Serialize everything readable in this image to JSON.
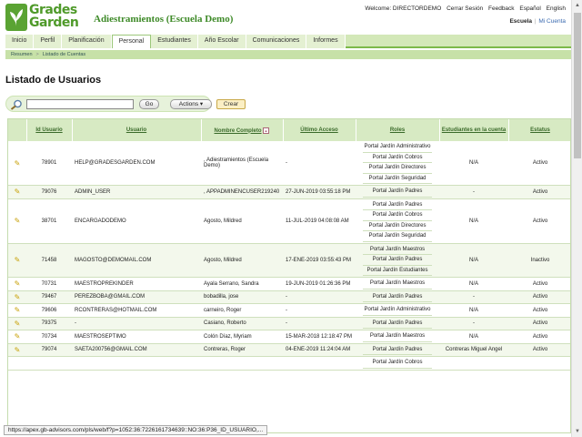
{
  "brand": {
    "logo_line1": "Grades",
    "logo_line2": "Garden",
    "app_title": "Adiestramientos (Escuela Demo)"
  },
  "top_links": {
    "welcome": "Welcome: DIRECTORDEMO",
    "logout": "Cerrar Sesión",
    "feedback": "Feedback",
    "lang_es": "Español",
    "lang_en": "English"
  },
  "account": {
    "school": "Escuela",
    "sep": "|",
    "my_account": "Mi Cuenta"
  },
  "nav": {
    "tabs": [
      "Inicio",
      "Perfil",
      "Planificación",
      "Personal",
      "Estudiantes",
      "Año Escolar",
      "Comunicaciones",
      "Informes"
    ],
    "active": "Personal"
  },
  "breadcrumb": {
    "items": [
      "Resumen",
      "Listado de Cuentas"
    ],
    "sep": ">"
  },
  "page": {
    "title": "Listado de Usuarios"
  },
  "toolbar": {
    "search_value": "",
    "go_label": "Go",
    "actions_label": "Actions ▾",
    "create_label": "Crear"
  },
  "table": {
    "headers": [
      "Id Usuario",
      "Usuario",
      "Nombre Completo",
      "Último Acceso",
      "Roles",
      "Estudiantes en la cuenta",
      "Estatus"
    ],
    "sort_arrow": "▲",
    "edit_icon": "✎",
    "rows": [
      {
        "id": "78901",
        "user": "HELP@GRADESGARDEN.COM",
        "name": ", Adiestramientos (Escuela Demo)",
        "last": "-",
        "roles": [
          "Portal Jardín Administrativo",
          "Portal Jardín Cobros",
          "Portal Jardín Directores",
          "Portal Jardín Seguridad"
        ],
        "students": "N/A",
        "status": "Activo"
      },
      {
        "id": "79076",
        "user": "ADMIN_USER",
        "name": ", APPADMINENCUSER219240",
        "last": "27-JUN-2019 03:55:18 PM",
        "roles": [
          "Portal Jardín Padres"
        ],
        "students": "-",
        "status": "Activo"
      },
      {
        "id": "38701",
        "user": "ENCARGADODEMO",
        "name": "Agosto, Mildred",
        "last": "11-JUL-2019 04:08:08 AM",
        "roles": [
          "Portal Jardín Padres",
          "Portal Jardín Cobros",
          "Portal Jardín Directores",
          "Portal Jardín Seguridad"
        ],
        "students": "N/A",
        "status": "Activo"
      },
      {
        "id": "71458",
        "user": "MAGOSTO@DEMOMAIL.COM",
        "name": "Agosto, Mildred",
        "last": "17-ENE-2019 03:55:43 PM",
        "roles": [
          "Portal Jardín Maestros",
          "Portal Jardín Padres",
          "Portal Jardín Estudiantes"
        ],
        "students": "N/A",
        "status": "Inactivo"
      },
      {
        "id": "70731",
        "user": "MAESTROPREKINDER",
        "name": "Ayala Serrano, Sandra",
        "last": "19-JUN-2019 01:26:36 PM",
        "roles": [
          "Portal Jardín Maestros"
        ],
        "students": "N/A",
        "status": "Activo"
      },
      {
        "id": "79467",
        "user": "PEREZBOBA@GMAIL.COM",
        "name": "bobadilla, jose",
        "last": "-",
        "roles": [
          "Portal Jardín Padres"
        ],
        "students": "-",
        "status": "Activo"
      },
      {
        "id": "79606",
        "user": "RCONTRERAS@HOTMAIL.COM",
        "name": "carneiro, Roger",
        "last": "-",
        "roles": [
          "Portal Jardín Administrativo"
        ],
        "students": "N/A",
        "status": "Activo"
      },
      {
        "id": "79375",
        "user": "-",
        "name": "Casiano, Roberto",
        "last": "-",
        "roles": [
          "Portal Jardín Padres"
        ],
        "students": "-",
        "status": "Activo"
      },
      {
        "id": "70734",
        "user": "MAESTROSEPTIMO",
        "name": "Colón Díaz, Myriam",
        "last": "15-MAR-2018 12:18:47 PM",
        "roles": [
          "Portal Jardín Maestros"
        ],
        "students": "N/A",
        "status": "Activo"
      },
      {
        "id": "79074",
        "user": "SAETA200756@GMAIL.COM",
        "name": "Contreras, Roger",
        "last": "04-ENE-2019 11:24:04 AM",
        "roles": [
          "Portal Jardín Padres"
        ],
        "students": "Contreras Miguel Angel",
        "status": "Activo"
      },
      {
        "id": "",
        "user": "",
        "name": "",
        "last": "",
        "roles": [
          "Portal Jardín Cobros"
        ],
        "students": "",
        "status": ""
      }
    ]
  },
  "status_url": "https://apex.gb-advisors.com/pls/web/f?p=1052:36:7226161734639::NO:36:P36_ID_USUARIO,..."
}
